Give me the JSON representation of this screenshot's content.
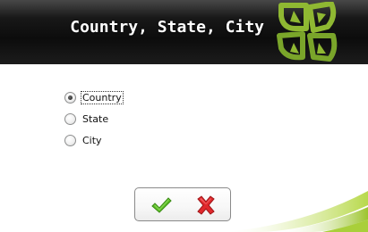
{
  "header": {
    "title": "Country, State, City",
    "logo_icon": "clover-logo-icon",
    "accent_color": "#8fb832"
  },
  "options": [
    {
      "label": "Country",
      "checked": true,
      "focused": true
    },
    {
      "label": "State",
      "checked": false,
      "focused": false
    },
    {
      "label": "City",
      "checked": false,
      "focused": false
    }
  ],
  "buttons": {
    "ok_icon": "checkmark-icon",
    "ok_color": "#4caf1e",
    "cancel_icon": "x-icon",
    "cancel_color": "#d8262a"
  }
}
